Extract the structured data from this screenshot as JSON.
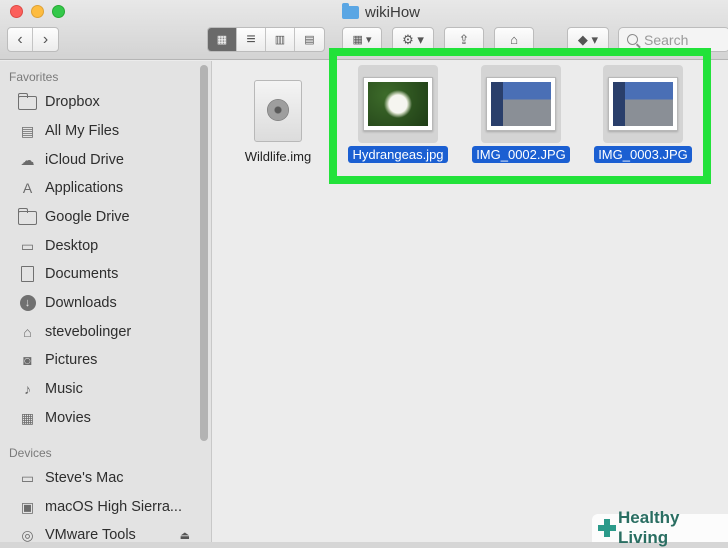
{
  "window": {
    "title": "wikiHow"
  },
  "toolbar": {
    "search_placeholder": "Search"
  },
  "sidebar": {
    "favorites_header": "Favorites",
    "favorites": [
      {
        "label": "Dropbox",
        "icon": "folder-icon"
      },
      {
        "label": "All My Files",
        "icon": "all-files-icon"
      },
      {
        "label": "iCloud Drive",
        "icon": "cloud-icon"
      },
      {
        "label": "Applications",
        "icon": "applications-icon"
      },
      {
        "label": "Google Drive",
        "icon": "folder-icon"
      },
      {
        "label": "Desktop",
        "icon": "desktop-icon"
      },
      {
        "label": "Documents",
        "icon": "documents-icon"
      },
      {
        "label": "Downloads",
        "icon": "downloads-icon"
      },
      {
        "label": "stevebolinger",
        "icon": "home-icon"
      },
      {
        "label": "Pictures",
        "icon": "camera-icon"
      },
      {
        "label": "Music",
        "icon": "music-icon"
      },
      {
        "label": "Movies",
        "icon": "film-icon"
      }
    ],
    "devices_header": "Devices",
    "devices": [
      {
        "label": "Steve's Mac",
        "icon": "computer-icon"
      },
      {
        "label": "macOS High Sierra...",
        "icon": "disk-icon"
      },
      {
        "label": "VMware Tools",
        "icon": "disc-icon"
      }
    ]
  },
  "files": [
    {
      "name": "Wildlife.img",
      "selected": false,
      "kind": "disk-image"
    },
    {
      "name": "Hydrangeas.jpg",
      "selected": true,
      "kind": "photo"
    },
    {
      "name": "IMG_0002.JPG",
      "selected": true,
      "kind": "photo"
    },
    {
      "name": "IMG_0003.JPG",
      "selected": true,
      "kind": "photo"
    }
  ],
  "watermark": {
    "text": "Healthy Living"
  },
  "colors": {
    "highlight": "#22e23a",
    "selection": "#1b5fd2"
  }
}
